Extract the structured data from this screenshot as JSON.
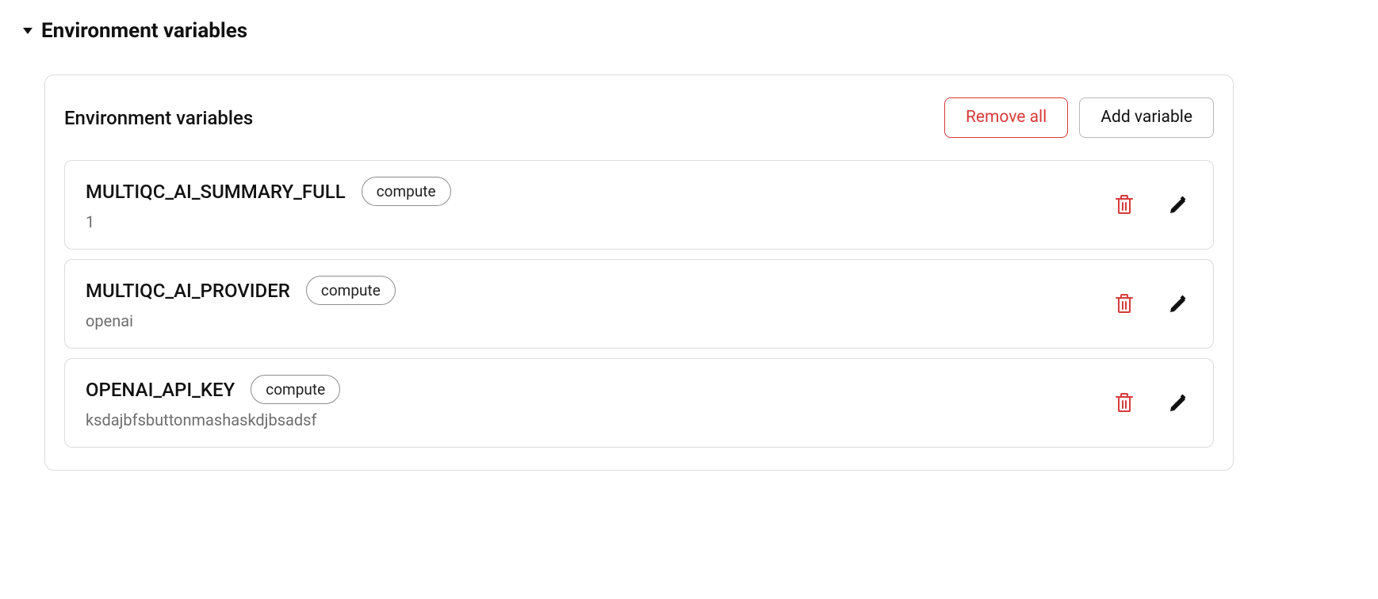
{
  "section": {
    "title": "Environment variables"
  },
  "card": {
    "title": "Environment variables",
    "remove_all_label": "Remove all",
    "add_variable_label": "Add variable"
  },
  "variables": [
    {
      "name": "MULTIQC_AI_SUMMARY_FULL",
      "tag": "compute",
      "value": "1"
    },
    {
      "name": "MULTIQC_AI_PROVIDER",
      "tag": "compute",
      "value": "openai"
    },
    {
      "name": "OPENAI_API_KEY",
      "tag": "compute",
      "value": "ksdajbfsbuttonmashaskdjbsadsf"
    }
  ]
}
